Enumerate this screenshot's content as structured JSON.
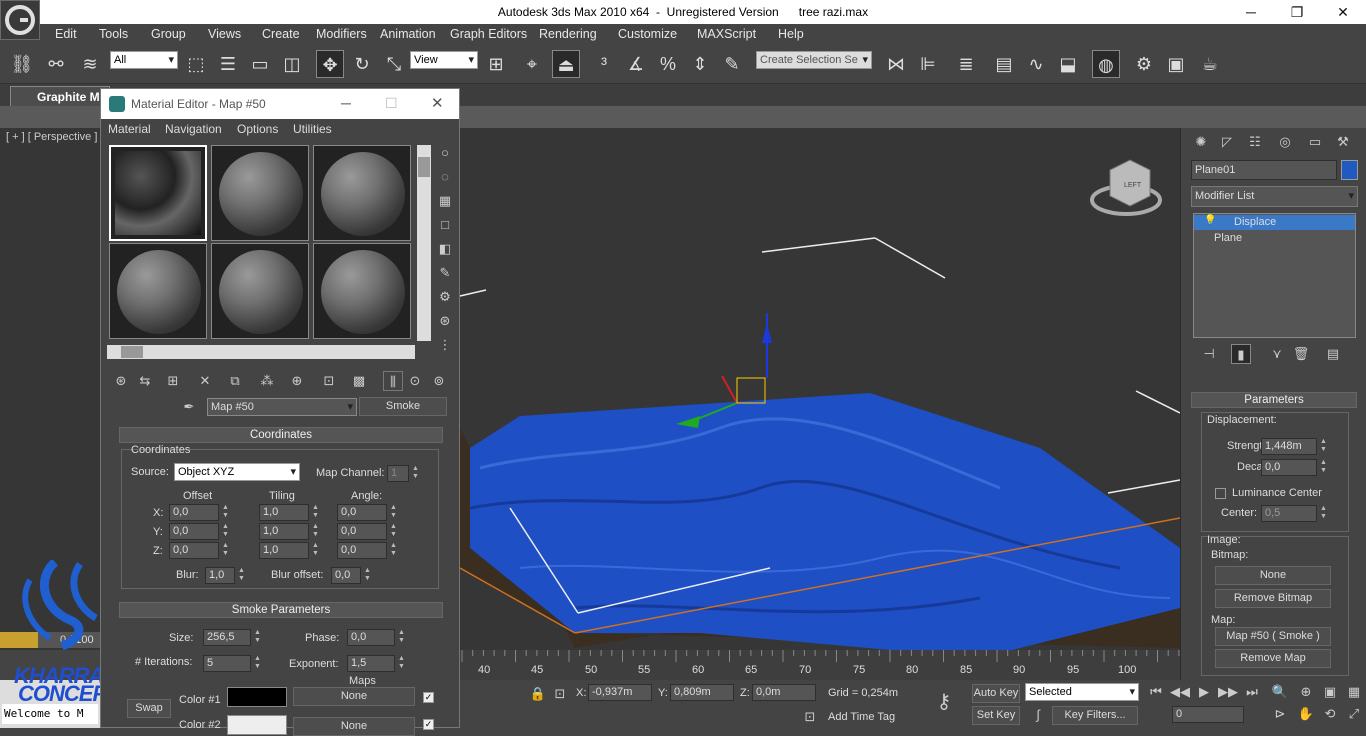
{
  "title": {
    "app": "Autodesk 3ds Max  2010 x64",
    "status": "Unregistered Version",
    "file": "tree razi.max"
  },
  "menubar": [
    "Edit",
    "Tools",
    "Group",
    "Views",
    "Create",
    "Modifiers",
    "Animation",
    "Graph Editors",
    "Rendering",
    "Customize",
    "MAXScript",
    "Help"
  ],
  "toolbar": {
    "filter": "All",
    "ref_coord": "View",
    "named_sel": "Create Selection Se"
  },
  "ribbon": {
    "tab": "Graphite Mo"
  },
  "viewport": {
    "label": "[ + ] [ Perspective ]",
    "viewcube": "LEFT"
  },
  "material_editor": {
    "title": "Material Editor - Map #50",
    "menu": [
      "Material",
      "Navigation",
      "Options",
      "Utilities"
    ],
    "map_name": "Map #50",
    "map_type": "Smoke",
    "coordinates": {
      "header": "Coordinates",
      "group": "Coordinates",
      "source_label": "Source:",
      "source": "Object XYZ",
      "map_channel_label": "Map Channel:",
      "map_channel": "1",
      "col_offset": "Offset",
      "col_tiling": "Tiling",
      "col_angle": "Angle:",
      "rows": [
        {
          "axis": "X:",
          "offset": "0,0",
          "tiling": "1,0",
          "angle": "0,0"
        },
        {
          "axis": "Y:",
          "offset": "0,0",
          "tiling": "1,0",
          "angle": "0,0"
        },
        {
          "axis": "Z:",
          "offset": "0,0",
          "tiling": "1,0",
          "angle": "0,0"
        }
      ],
      "blur_label": "Blur:",
      "blur": "1,0",
      "blur_offset_label": "Blur offset:",
      "blur_offset": "0,0"
    },
    "smoke": {
      "header": "Smoke Parameters",
      "size_label": "Size:",
      "size": "256,5",
      "phase_label": "Phase:",
      "phase": "0,0",
      "iter_label": "# Iterations:",
      "iter": "5",
      "exp_label": "Exponent:",
      "exp": "1,5",
      "maps_label": "Maps",
      "color1_label": "Color #1",
      "color2_label": "Color #2",
      "swap": "Swap",
      "none1": "None",
      "none2": "None"
    }
  },
  "command_panel": {
    "object_name": "Plane01",
    "modifier_list": "Modifier List",
    "stack": [
      "Displace",
      "Plane"
    ],
    "params_header": "Parameters",
    "displacement": "Displacement:",
    "strength_label": "Strength:",
    "strength": "1,448m",
    "decay_label": "Decay:",
    "decay": "0,0",
    "lum_center": "Luminance Center",
    "center_label": "Center:",
    "center": "0,5",
    "image": "Image:",
    "bitmap": "Bitmap:",
    "none": "None",
    "remove_bitmap": "Remove Bitmap",
    "map_label": "Map:",
    "map_btn": "Map #50  ( Smoke )",
    "remove_map": "Remove Map"
  },
  "timeline": {
    "ticks": [
      "40",
      "45",
      "50",
      "55",
      "60",
      "65",
      "70",
      "75",
      "80",
      "85",
      "90",
      "95",
      "100"
    ],
    "frame": "0 / 100"
  },
  "status": {
    "x_label": "X:",
    "x": "-0,937m",
    "y_label": "Y:",
    "y": "0,809m",
    "z_label": "Z:",
    "z": "0,0m",
    "grid": "Grid = 0,254m",
    "add_time_tag": "Add Time Tag",
    "auto_key": "Auto Key",
    "set_key": "Set Key",
    "selected": "Selected",
    "key_filters": "Key Filters...",
    "frame_field": "0",
    "welcome": "Welcome to M"
  },
  "logo": {
    "line1": "KHARRAZI",
    "line2": "CONCEPT"
  },
  "colors": {
    "plane": "#1f4fc4",
    "accent": "#3a78c8"
  }
}
